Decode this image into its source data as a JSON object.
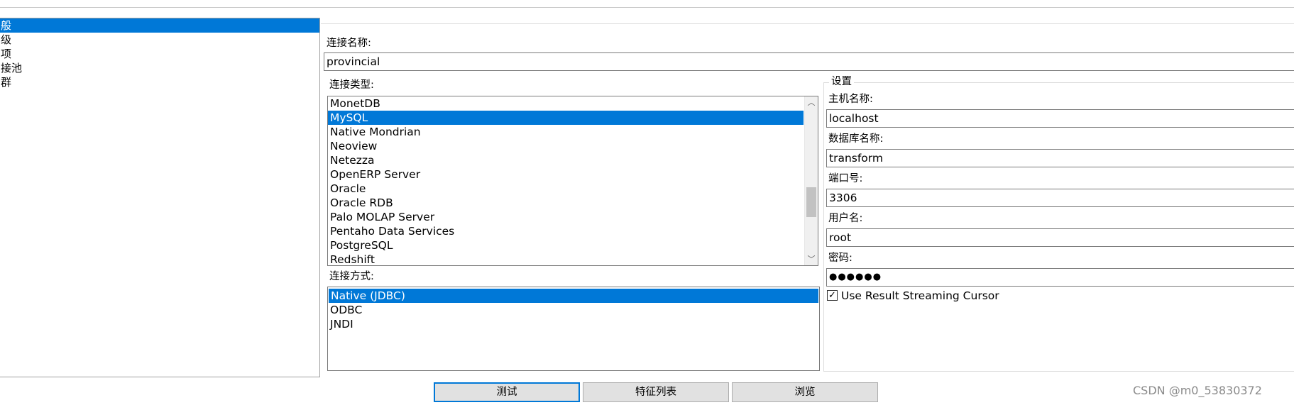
{
  "nav": {
    "items": [
      "般",
      "级",
      "项",
      "接池",
      "群"
    ],
    "selected_index": 0
  },
  "connection_name": {
    "label": "连接名称:",
    "value": "provincial"
  },
  "connection_type": {
    "label": "连接类型:",
    "items": [
      "MonetDB",
      "MySQL",
      "Native Mondrian",
      "Neoview",
      "Netezza",
      "OpenERP Server",
      "Oracle",
      "Oracle RDB",
      "Palo MOLAP Server",
      "Pentaho Data Services",
      "PostgreSQL",
      "Redshift"
    ],
    "selected": "MySQL"
  },
  "access_method": {
    "label": "连接方式:",
    "items": [
      "Native (JDBC)",
      "ODBC",
      "JNDI"
    ],
    "selected": "Native (JDBC)"
  },
  "settings": {
    "title": "设置",
    "host_label": "主机名称:",
    "host_value": "localhost",
    "db_label": "数据库名称:",
    "db_value": "transform",
    "port_label": "端口号:",
    "port_value": "3306",
    "user_label": "用户名:",
    "user_value": "root",
    "password_label": "密码:",
    "password_value": "●●●●●●",
    "streaming_label": "Use Result Streaming Cursor",
    "streaming_checked": true,
    "check_glyph": "✓"
  },
  "buttons": {
    "test": "测试",
    "features": "特征列表",
    "browse": "浏览"
  },
  "icons": {
    "scroll_up": "chevron-up-icon",
    "scroll_down": "chevron-down-icon",
    "up_glyph": "︿",
    "down_glyph": "﹀"
  },
  "watermark": "CSDN @m0_53830372",
  "colors": {
    "selection": "#0078d7",
    "button_face": "#e1e1e1"
  }
}
